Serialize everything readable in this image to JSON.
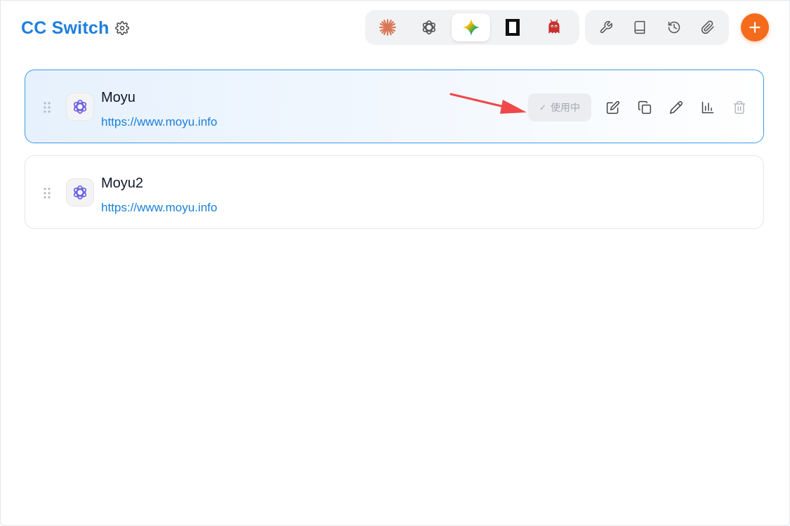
{
  "header": {
    "title": "CC Switch",
    "settings_icon": "gear-icon"
  },
  "app_tabs": [
    {
      "name": "claude",
      "icon": "claude-asterisk-icon",
      "color": "#d97757",
      "active": false
    },
    {
      "name": "codex",
      "icon": "openai-icon",
      "color": "#555555",
      "active": false
    },
    {
      "name": "gemini",
      "icon": "gemini-sparkle-icon",
      "color": "#4285f4",
      "active": true
    },
    {
      "name": "terminal",
      "icon": "terminal-window-icon",
      "color": "#111111",
      "active": false
    },
    {
      "name": "mascot",
      "icon": "red-mascot-icon",
      "color": "#c9302c",
      "active": false
    }
  ],
  "tools": [
    {
      "name": "tools",
      "icon": "wrench-icon"
    },
    {
      "name": "prompts",
      "icon": "book-icon"
    },
    {
      "name": "history",
      "icon": "history-icon"
    },
    {
      "name": "attachments",
      "icon": "paperclip-icon"
    }
  ],
  "add_button": {
    "label": "+",
    "icon": "plus-icon",
    "color": "#f46b1d"
  },
  "providers": [
    {
      "name": "Moyu",
      "url": "https://www.moyu.info",
      "icon": "openai-icon",
      "active": true,
      "status_label": "使用中",
      "actions": [
        "edit-icon",
        "copy-icon",
        "pencil-icon",
        "bar-chart-icon",
        "trash-icon"
      ]
    },
    {
      "name": "Moyu2",
      "url": "https://www.moyu.info",
      "icon": "openai-icon",
      "active": false
    }
  ],
  "colors": {
    "accent": "#1e7fe0",
    "active_border": "#3d9be9",
    "annotation_arrow": "#f0474a"
  }
}
